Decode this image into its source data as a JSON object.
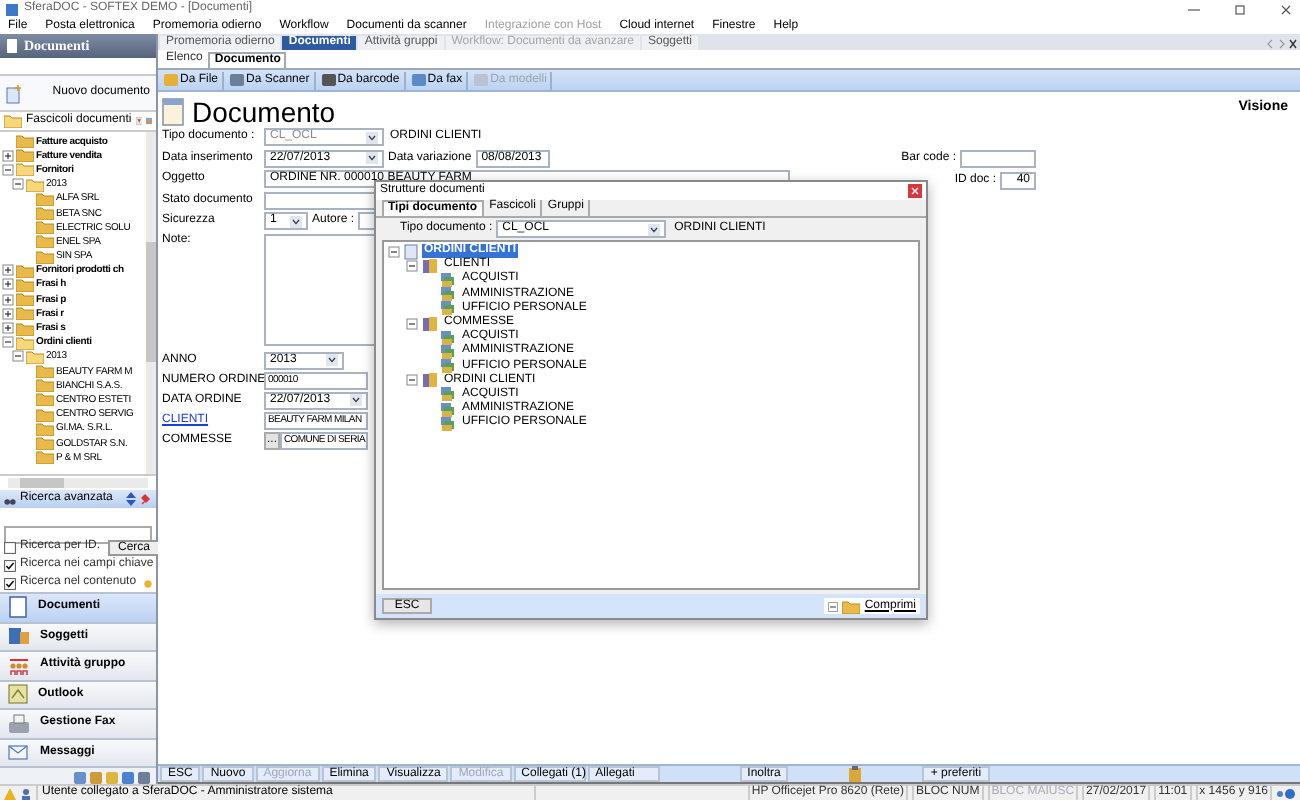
{
  "window": {
    "title": "SferaDOC - SOFTEX DEMO - [Documenti]"
  },
  "menu": [
    {
      "label": "File",
      "disabled": false
    },
    {
      "label": "Posta elettronica",
      "disabled": false
    },
    {
      "label": "Promemoria odierno",
      "disabled": false
    },
    {
      "label": "Workflow",
      "disabled": false
    },
    {
      "label": "Documenti da scanner",
      "disabled": false
    },
    {
      "label": "Integrazione con Host",
      "disabled": true
    },
    {
      "label": "Cloud internet",
      "disabled": false
    },
    {
      "label": "Finestre",
      "disabled": false
    },
    {
      "label": "Help",
      "disabled": false
    }
  ],
  "sidebar": {
    "title": "Documenti",
    "new_document": "Nuovo documento",
    "folder_selector": "Fascicoli documenti",
    "tree": [
      {
        "label": "Fatture acquisto"
      },
      {
        "label": "Fatture vendita",
        "expanded": false
      },
      {
        "label": "Fornitori",
        "expanded": true,
        "children": [
          {
            "label": "2013",
            "expanded": true,
            "children": [
              {
                "label": "ALFA SRL"
              },
              {
                "label": "BETA SNC"
              },
              {
                "label": "ELECTRIC SOLU"
              },
              {
                "label": "ENEL SPA"
              },
              {
                "label": "SIN SPA"
              }
            ]
          }
        ]
      },
      {
        "label": "Fornitori prodotti ch",
        "expanded": false
      },
      {
        "label": "Frasi h",
        "expanded": false
      },
      {
        "label": "Frasi p",
        "expanded": false
      },
      {
        "label": "Frasi r",
        "expanded": false
      },
      {
        "label": "Frasi s",
        "expanded": false
      },
      {
        "label": "Ordini clienti",
        "expanded": true,
        "children": [
          {
            "label": "2013",
            "expanded": true,
            "children": [
              {
                "label": "BEAUTY FARM M"
              },
              {
                "label": "BIANCHI S.A.S."
              },
              {
                "label": "CENTRO ESTETI"
              },
              {
                "label": "CENTRO SERVIG"
              },
              {
                "label": "GI.MA. S.R.L."
              },
              {
                "label": "GOLDSTAR S.N."
              },
              {
                "label": "P & M SRL"
              }
            ]
          }
        ]
      }
    ],
    "search": {
      "title": "Ricerca avanzata",
      "button": "Cerca",
      "options": [
        {
          "label": "Ricerca per ID.",
          "checked": false
        },
        {
          "label": "Ricerca nei campi chiave",
          "checked": true
        },
        {
          "label": "Ricerca nel contenuto",
          "checked": true
        }
      ]
    },
    "nav": [
      {
        "label": "Documenti",
        "selected": true,
        "kind": "doc"
      },
      {
        "label": "Soggetti",
        "selected": false,
        "kind": "people"
      },
      {
        "label": "Attività gruppo",
        "selected": false,
        "kind": "group"
      },
      {
        "label": "Outlook",
        "selected": false,
        "kind": "outlook"
      },
      {
        "label": "Gestione Fax",
        "selected": false,
        "kind": "fax"
      },
      {
        "label": "Messaggi",
        "selected": false,
        "kind": "mail"
      }
    ]
  },
  "tabs": [
    {
      "label": "Promemoria odierno",
      "selected": false,
      "disabled": false
    },
    {
      "label": "Documenti",
      "selected": true,
      "disabled": false
    },
    {
      "label": "Attività gruppi",
      "selected": false,
      "disabled": false
    },
    {
      "label": "Workflow: Documenti da avanzare",
      "selected": false,
      "disabled": true
    },
    {
      "label": "Soggetti",
      "selected": false,
      "disabled": false
    }
  ],
  "subtabs": [
    {
      "label": "Elenco",
      "selected": false
    },
    {
      "label": "Documento",
      "selected": true
    }
  ],
  "toolbar": [
    {
      "label": "Da File",
      "disabled": false
    },
    {
      "label": "Da Scanner",
      "disabled": false
    },
    {
      "label": "Da barcode",
      "disabled": false
    },
    {
      "label": "Da fax",
      "disabled": false
    },
    {
      "label": "Da modelli",
      "disabled": true
    }
  ],
  "document": {
    "heading": "Documento",
    "mode": "Visione",
    "tipo_documento": {
      "label": "Tipo documento :",
      "value": "CL_OCL",
      "description": "ORDINI CLIENTI"
    },
    "data_inserimento": {
      "label": "Data inserimento",
      "value": "22/07/2013"
    },
    "data_variazione": {
      "label": "Data variazione",
      "value": "08/08/2013"
    },
    "bar_code": {
      "label": "Bar code :"
    },
    "id_doc": {
      "label": "ID doc :",
      "value": "40"
    },
    "oggetto": {
      "label": "Oggetto",
      "value": "ORDINE NR. 000010 BEAUTY FARM"
    },
    "stato": {
      "label": "Stato documento"
    },
    "sicurezza": {
      "label": "Sicurezza",
      "value": "1"
    },
    "autore": {
      "label": "Autore :"
    },
    "note": {
      "label": "Note:"
    },
    "fields": [
      {
        "label": "ANNO",
        "value": "2013",
        "kind": "combo",
        "link": false
      },
      {
        "label": "NUMERO ORDINE",
        "value": "000010",
        "kind": "text",
        "link": false
      },
      {
        "label": "DATA ORDINE",
        "value": "22/07/2013",
        "kind": "date",
        "link": false
      },
      {
        "label": "CLIENTI",
        "value": "BEAUTY FARM MILAN",
        "kind": "text",
        "link": true
      },
      {
        "label": "COMMESSE",
        "value": "COMUNE DI SERIA",
        "kind": "lookup",
        "button": "...",
        "link": false
      }
    ]
  },
  "actions": [
    {
      "label": "ESC",
      "disabled": false
    },
    {
      "label": "Nuovo",
      "disabled": false
    },
    {
      "label": "Aggiorna",
      "disabled": true
    },
    {
      "label": "Elimina",
      "disabled": false
    },
    {
      "label": "Visualizza",
      "disabled": false
    },
    {
      "label": "Modifica",
      "disabled": true
    },
    {
      "label": "Collegati (1)",
      "disabled": false
    },
    {
      "label": "Allegati",
      "disabled": false
    },
    {
      "label": "Inoltra",
      "disabled": false
    },
    {
      "label": "+ preferiti",
      "disabled": false
    }
  ],
  "dialog": {
    "title": "Strutture documenti",
    "tabs": [
      {
        "label": "Tipi documento",
        "selected": true
      },
      {
        "label": "Fascicoli",
        "selected": false
      },
      {
        "label": "Gruppi",
        "selected": false
      }
    ],
    "tipo_label": "Tipo documento :",
    "tipo_value": "CL_OCL",
    "tipo_description": "ORDINI CLIENTI",
    "tree": [
      {
        "label": "ORDINI CLIENTI",
        "kind": "root",
        "selected": true,
        "expanded": true,
        "children": [
          {
            "label": "CLIENTI",
            "kind": "folder",
            "selected": false,
            "expanded": true,
            "children": [
              {
                "label": "ACQUISTI",
                "kind": "leaf",
                "selected": false
              },
              {
                "label": "AMMINISTRAZIONE",
                "kind": "leaf",
                "selected": false
              },
              {
                "label": "UFFICIO PERSONALE",
                "kind": "leaf",
                "selected": false
              }
            ]
          },
          {
            "label": "COMMESSE",
            "kind": "folder",
            "selected": false,
            "expanded": true,
            "children": [
              {
                "label": "ACQUISTI",
                "kind": "leaf",
                "selected": false
              },
              {
                "label": "AMMINISTRAZIONE",
                "kind": "leaf",
                "selected": false
              },
              {
                "label": "UFFICIO PERSONALE",
                "kind": "leaf",
                "selected": false
              }
            ]
          },
          {
            "label": "ORDINI CLIENTI",
            "kind": "folder",
            "selected": false,
            "expanded": true,
            "children": [
              {
                "label": "ACQUISTI",
                "kind": "leaf",
                "selected": false
              },
              {
                "label": "AMMINISTRAZIONE",
                "kind": "leaf",
                "selected": false
              },
              {
                "label": "UFFICIO PERSONALE",
                "kind": "leaf",
                "selected": false
              }
            ]
          }
        ]
      }
    ],
    "esc": "ESC",
    "collapse": "Comprimi"
  },
  "status_bar": {
    "message": "Utente collegato a SferaDOC - Amministratore sistema",
    "panels": [
      {
        "label": "HP Officejet Pro 8620 (Rete)",
        "disabled": false
      },
      {
        "label": "BLOC NUM",
        "disabled": false
      },
      {
        "label": "BLOC MAIUSC",
        "disabled": true
      },
      {
        "label": "27/02/2017",
        "disabled": false
      },
      {
        "label": "11:01",
        "disabled": false
      },
      {
        "label": "x 1456 y 916",
        "disabled": false
      }
    ]
  }
}
